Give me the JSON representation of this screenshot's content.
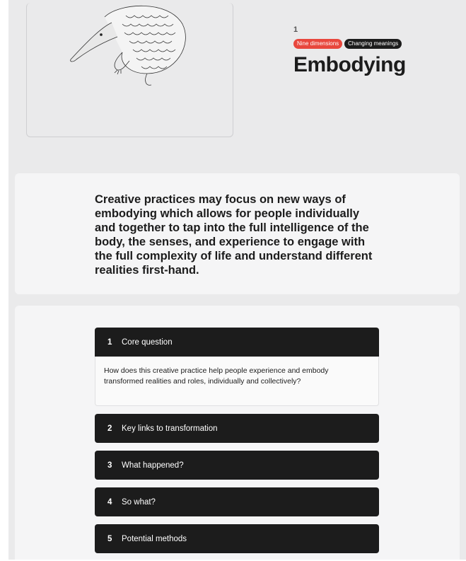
{
  "hero": {
    "number": "1",
    "tags": [
      {
        "label": "Nine dimensions",
        "color": "#e8473d"
      },
      {
        "label": "Changing meanings",
        "color": "#1c1c1c"
      }
    ],
    "title": "Embodying",
    "illustration_icon": "pangolin-illustration"
  },
  "intro": {
    "text": "Creative practices may focus on new ways of embodying which allows for people individually and together to tap into the full intelligence of the body, the senses, and experience to engage with the full complexity of life and understand different realities first-hand."
  },
  "accordion": [
    {
      "number": "1",
      "label": "Core question",
      "open": true,
      "body": "How does this creative practice help people experience and embody transformed realities and roles, individually and collectively?"
    },
    {
      "number": "2",
      "label": "Key links to transformation",
      "open": false
    },
    {
      "number": "3",
      "label": "What happened?",
      "open": false
    },
    {
      "number": "4",
      "label": "So what?",
      "open": false
    },
    {
      "number": "5",
      "label": "Potential methods",
      "open": false
    }
  ]
}
